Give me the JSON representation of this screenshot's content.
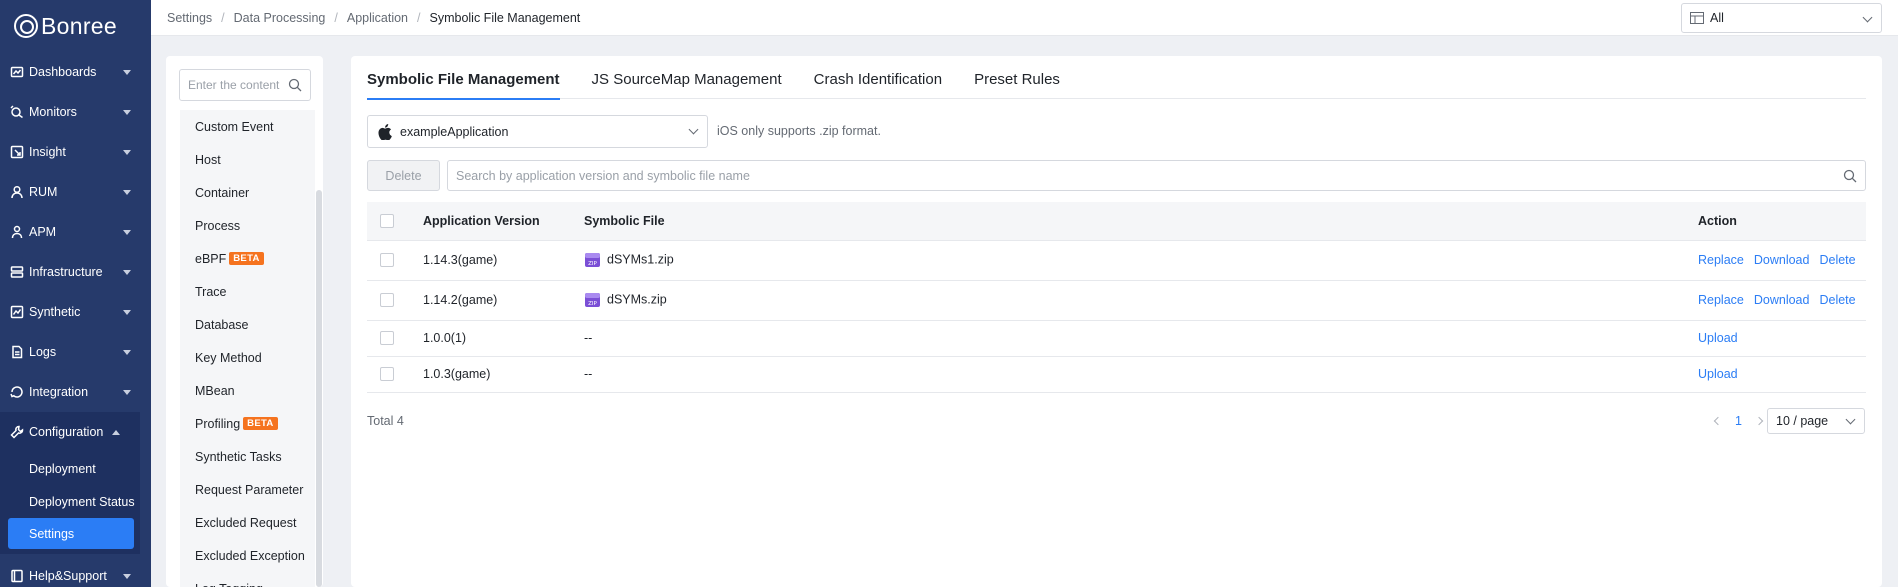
{
  "brand": {
    "name": "Bonree"
  },
  "sidebar": {
    "items": [
      {
        "label": "Dashboards",
        "icon": "dashboard-icon"
      },
      {
        "label": "Monitors",
        "icon": "monitor-icon"
      },
      {
        "label": "Insight",
        "icon": "insight-icon"
      },
      {
        "label": "RUM",
        "icon": "rum-icon"
      },
      {
        "label": "APM",
        "icon": "apm-icon"
      },
      {
        "label": "Infrastructure",
        "icon": "infrastructure-icon"
      },
      {
        "label": "Synthetic",
        "icon": "synthetic-icon"
      },
      {
        "label": "Logs",
        "icon": "logs-icon"
      },
      {
        "label": "Integration",
        "icon": "integration-icon"
      },
      {
        "label": "Configuration",
        "icon": "wrench-icon"
      }
    ],
    "config_sub": [
      "Deployment",
      "Deployment Status",
      "Settings"
    ],
    "help": {
      "label": "Help&Support",
      "icon": "book-icon"
    }
  },
  "breadcrumb": [
    "Settings",
    "Data Processing",
    "Application",
    "Symbolic File Management"
  ],
  "scope_select": {
    "value": "All"
  },
  "left_panel": {
    "search_placeholder": "Enter the content",
    "items": [
      {
        "label": "Custom Event"
      },
      {
        "label": "Host"
      },
      {
        "label": "Container"
      },
      {
        "label": "Process"
      },
      {
        "label": "eBPF",
        "badge": "BETA"
      },
      {
        "label": "Trace"
      },
      {
        "label": "Database"
      },
      {
        "label": "Key Method"
      },
      {
        "label": "MBean"
      },
      {
        "label": "Profiling",
        "badge": "BETA"
      },
      {
        "label": "Synthetic Tasks"
      },
      {
        "label": "Request Parameter"
      },
      {
        "label": "Excluded Request"
      },
      {
        "label": "Excluded Exception"
      },
      {
        "label": "Log Tagging"
      }
    ]
  },
  "tabs": [
    "Symbolic File Management",
    "JS SourceMap Management",
    "Crash Identification",
    "Preset Rules"
  ],
  "app_select": {
    "value": "exampleApplication"
  },
  "ios_note": "iOS only supports .zip format.",
  "delete_label": "Delete",
  "search_placeholder": "Search by application version and symbolic file name",
  "table": {
    "headers": [
      "Application Version",
      "Symbolic File",
      "Action"
    ],
    "rows": [
      {
        "version": "1.14.3(game)",
        "file": "dSYMs1.zip",
        "actions": [
          "Replace",
          "Download",
          "Delete"
        ]
      },
      {
        "version": "1.14.2(game)",
        "file": "dSYMs.zip",
        "actions": [
          "Replace",
          "Download",
          "Delete"
        ]
      },
      {
        "version": "1.0.0(1)",
        "file": "--",
        "actions": [
          "Upload"
        ]
      },
      {
        "version": "1.0.3(game)",
        "file": "--",
        "actions": [
          "Upload"
        ]
      }
    ]
  },
  "footer": {
    "total": "Total 4",
    "page": "1",
    "page_size": "10 / page"
  },
  "colors": {
    "sidebar": "#263a6b",
    "accent": "#2b7df5",
    "beta": "#f5731f"
  }
}
